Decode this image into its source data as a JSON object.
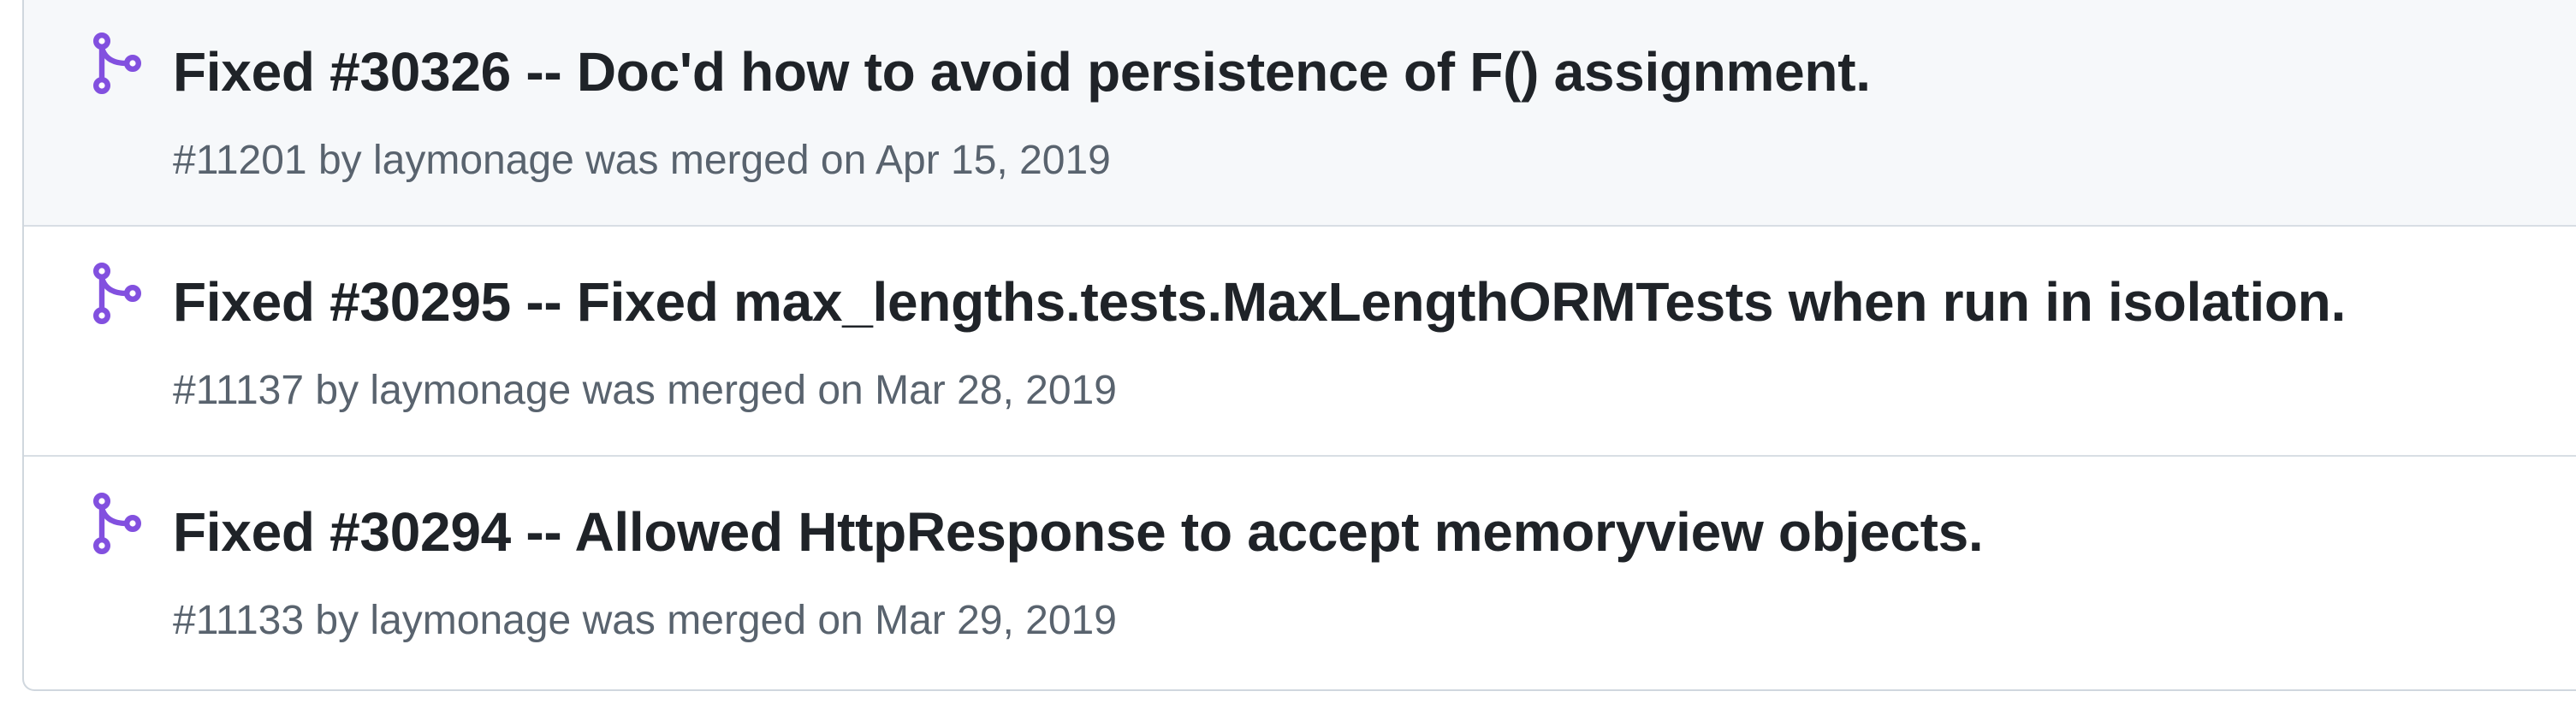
{
  "colors": {
    "merged_icon": "#8250df",
    "title_text": "#1f2328",
    "meta_text": "#59636e",
    "row_border": "#d8dee4",
    "row_hover_bg": "#f6f8fa"
  },
  "pull_requests": [
    {
      "icon": "git-merge-icon",
      "title": "Fixed #30326 -- Doc'd how to avoid persistence of F() assignment.",
      "meta": "#11201 by laymonage was merged on Apr 15, 2019"
    },
    {
      "icon": "git-merge-icon",
      "title": "Fixed #30295 -- Fixed max_lengths.tests.MaxLengthORMTests when run in isolation.",
      "meta": "#11137 by laymonage was merged on Mar 28, 2019"
    },
    {
      "icon": "git-merge-icon",
      "title": "Fixed #30294 -- Allowed HttpResponse to accept memoryview objects.",
      "meta": "#11133 by laymonage was merged on Mar 29, 2019"
    }
  ]
}
